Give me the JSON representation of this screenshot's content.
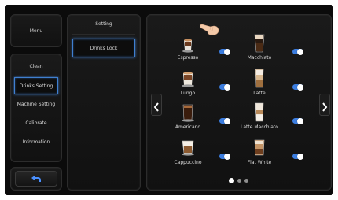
{
  "menu": {
    "label": "Menu"
  },
  "sidebar": {
    "items": [
      {
        "label": "Clean",
        "selected": false
      },
      {
        "label": "Drinks Setting",
        "selected": true
      },
      {
        "label": "Machine Setting",
        "selected": false
      },
      {
        "label": "Calibrate",
        "selected": false
      },
      {
        "label": "Information",
        "selected": false
      }
    ]
  },
  "back": {
    "icon": "back-arrow-icon"
  },
  "submenu": {
    "title": "Setting",
    "items": [
      {
        "label": "Drinks Lock",
        "selected": true
      }
    ]
  },
  "drinks": [
    {
      "label": "Espresso",
      "icon": "espresso-cup-icon",
      "enabled": true
    },
    {
      "label": "Macchiato",
      "icon": "macchiato-glass-icon",
      "enabled": true
    },
    {
      "label": "Lungo",
      "icon": "lungo-cup-icon",
      "enabled": true
    },
    {
      "label": "Latte",
      "icon": "latte-glass-icon",
      "enabled": true
    },
    {
      "label": "Americano",
      "icon": "americano-cup-icon",
      "enabled": true
    },
    {
      "label": "Latte Macchiato",
      "icon": "latte-macchiato-glass-icon",
      "enabled": true
    },
    {
      "label": "Cappuccino",
      "icon": "cappuccino-cup-icon",
      "enabled": true
    },
    {
      "label": "Flat White",
      "icon": "flat-white-glass-icon",
      "enabled": true
    }
  ],
  "pagination": {
    "current_page": 1,
    "total_pages": 3
  },
  "colors": {
    "accent": "#3b7de0",
    "background": "#0b0b0b",
    "panel": "#151515"
  }
}
